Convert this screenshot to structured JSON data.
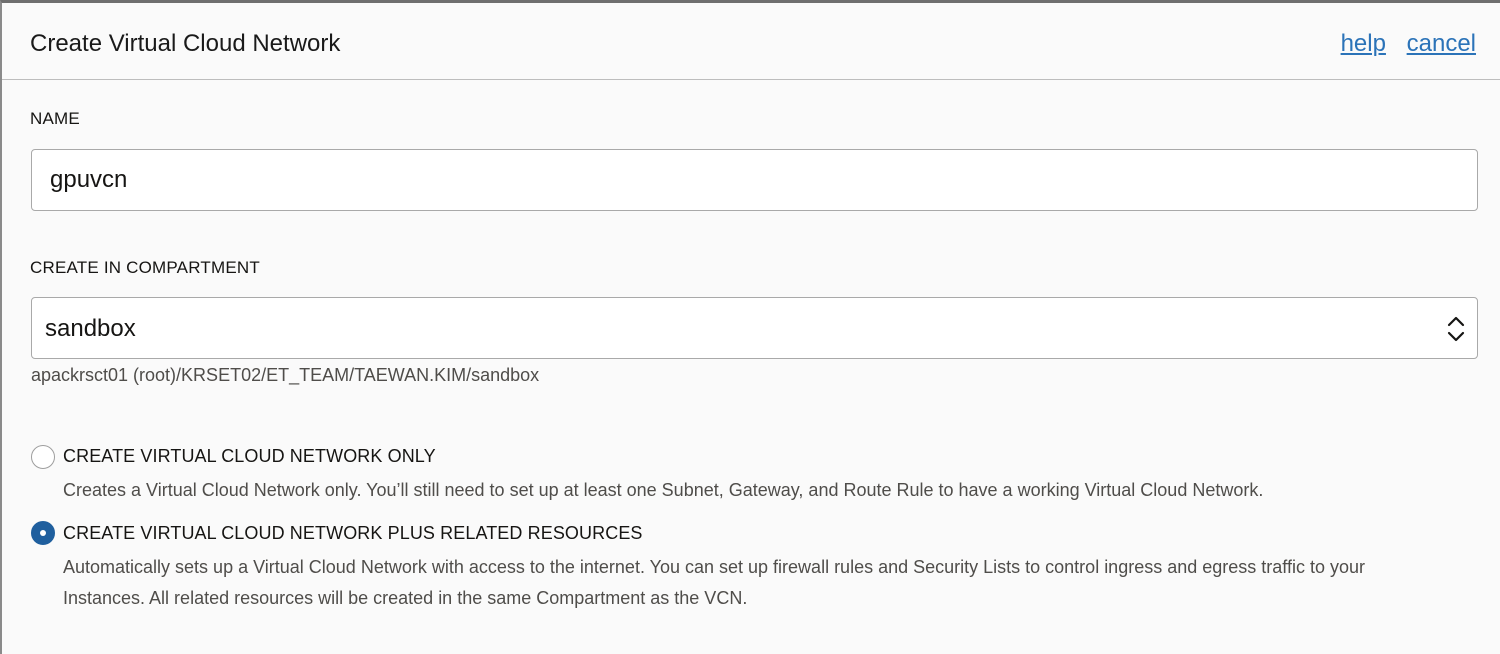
{
  "dialog": {
    "title": "Create Virtual Cloud Network",
    "help_link": "help",
    "cancel_link": "cancel"
  },
  "name_field": {
    "label": "NAME",
    "value": "gpuvcn"
  },
  "compartment": {
    "label": "CREATE IN COMPARTMENT",
    "selected": "sandbox",
    "path": "apackrsct01 (root)/KRSET02/ET_TEAM/TAEWAN.KIM/sandbox",
    "arrows_icon": "up-down-chevron-icon"
  },
  "options": [
    {
      "label": "CREATE VIRTUAL CLOUD NETWORK ONLY",
      "description": "Creates a Virtual Cloud Network only. You’ll still need to set up at least one Subnet, Gateway, and Route Rule to have a working Virtual Cloud Network.",
      "checked": false
    },
    {
      "label": "CREATE VIRTUAL CLOUD NETWORK PLUS RELATED RESOURCES",
      "description_line1": "Automatically sets up a Virtual Cloud Network with access to the internet. You can set up firewall rules and Security Lists to control ingress and egress traffic to your",
      "description_line2": "Instances. All related resources will be created in the same Compartment as the VCN.",
      "checked": true
    }
  ],
  "colors": {
    "link": "#2b73b8",
    "radio_checked": "#1f5f9e"
  }
}
